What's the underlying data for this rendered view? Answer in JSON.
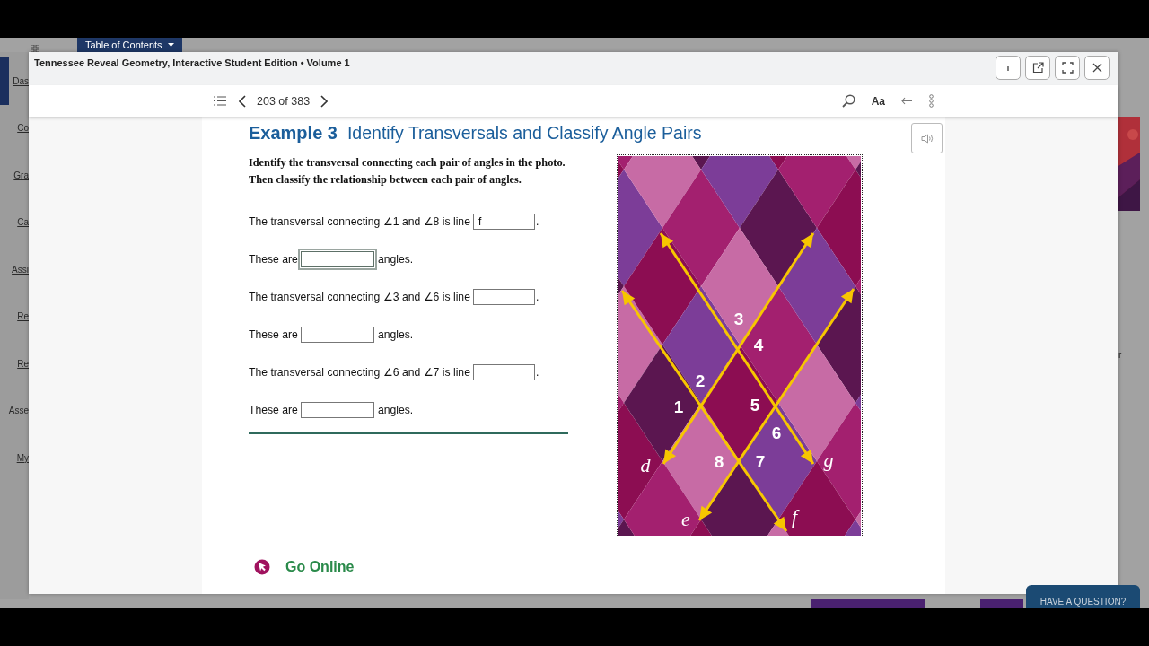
{
  "app": {
    "toc_button": "Table of Contents",
    "nav": [
      {
        "label": "Das",
        "selected": true
      },
      {
        "label": "Co",
        "selected": false
      },
      {
        "label": "Gra",
        "selected": false
      },
      {
        "label": "Ca",
        "selected": false
      },
      {
        "label": "Assi",
        "selected": false
      },
      {
        "label": "Re",
        "selected": false
      },
      {
        "label": "Re",
        "selected": false
      },
      {
        "label": "Asse",
        "selected": false
      },
      {
        "label": "My",
        "selected": false
      }
    ],
    "side_text": "r",
    "help_button": "HAVE A QUESTION?"
  },
  "viewer": {
    "title": "Tennessee Reveal Geometry, Interactive Student Edition • Volume 1",
    "info_button": "i",
    "page_indicator": "203 of 383",
    "font_button": "Aa"
  },
  "example": {
    "number": "Example 3",
    "title": "Identify Transversals and Classify Angle Pairs",
    "instructions": [
      "Identify the transversal connecting each pair of angles in the photo.",
      "Then classify the relationship between each pair of angles."
    ],
    "questions": [
      {
        "kind": "line",
        "text": "The transversal connecting ∠1 and ∠8 is line",
        "value": "f",
        "after": ".",
        "focused": false
      },
      {
        "kind": "angles",
        "text": "These are",
        "after": "angles.",
        "focused": true
      },
      {
        "kind": "line",
        "text": "The transversal connecting ∠3 and ∠6 is line",
        "after": ".",
        "focused": false
      },
      {
        "kind": "angles",
        "text": "These are",
        "after": "angles.",
        "focused": false
      },
      {
        "kind": "line",
        "text": "The transversal connecting ∠6 and ∠7 is line",
        "after": ".",
        "focused": false
      },
      {
        "kind": "angles",
        "text": "These are",
        "after": "angles.",
        "focused": false
      }
    ],
    "figure": {
      "labels": [
        {
          "kind": "angle",
          "text": "3"
        },
        {
          "kind": "angle",
          "text": "4"
        },
        {
          "kind": "angle",
          "text": "2"
        },
        {
          "kind": "angle",
          "text": "1"
        },
        {
          "kind": "angle",
          "text": "5"
        },
        {
          "kind": "angle",
          "text": "6"
        },
        {
          "kind": "line",
          "text": "d"
        },
        {
          "kind": "angle",
          "text": "8"
        },
        {
          "kind": "angle",
          "text": "7"
        },
        {
          "kind": "line",
          "text": "g"
        },
        {
          "kind": "line",
          "text": "e"
        },
        {
          "kind": "line",
          "text": "f"
        }
      ]
    },
    "go_online": "Go Online"
  }
}
